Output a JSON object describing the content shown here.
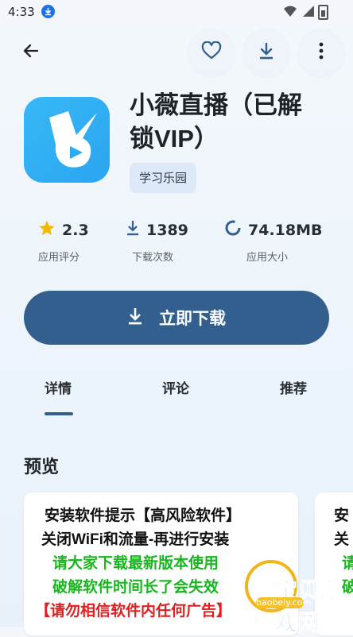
{
  "status_bar": {
    "time": "4:33",
    "icons": [
      "download-icon",
      "wifi-icon",
      "signal-icon",
      "battery-icon"
    ]
  },
  "top_bar": {
    "icons": [
      "back-arrow-icon",
      "heart-icon",
      "download-icon",
      "more-vert-icon"
    ]
  },
  "app": {
    "title_line1": "小薇直播（已解",
    "title_line2": "锁VIP）",
    "category": "学习乐园",
    "icon_color": "#38b8f6"
  },
  "stats": [
    {
      "value": "2.3",
      "label": "应用评分",
      "icon": "star-icon"
    },
    {
      "value": "1389",
      "label": "下载次数",
      "icon": "download-icon"
    },
    {
      "value": "74.18MB",
      "label": "应用大小",
      "icon": "size-ring-icon"
    }
  ],
  "download_button": {
    "label": "立即下载",
    "color": "#325f8d"
  },
  "tabs": [
    {
      "label": "详情",
      "active": true
    },
    {
      "label": "评论",
      "active": false
    },
    {
      "label": "推荐",
      "active": false
    }
  ],
  "preview": {
    "title": "预览",
    "shot1_lines": [
      "安装软件提示【高风险软件】",
      "关闭WiFi和流量-再进行安装",
      "请大家下载最新版本使用",
      "破解软件时间长了会失效",
      "【请勿相信软件内任何广告】"
    ],
    "shot2_lines": [
      "安",
      "关",
      "请",
      "破"
    ]
  },
  "watermark": {
    "text": "宝贝游戏网",
    "url": "baobeiy.com"
  }
}
